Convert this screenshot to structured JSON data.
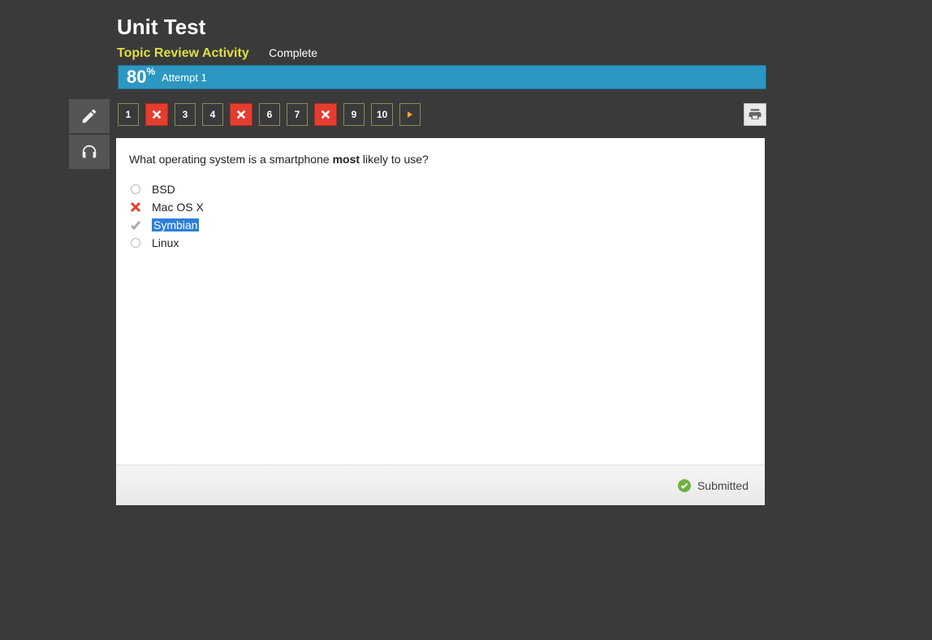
{
  "header": {
    "title": "Unit Test",
    "activity": "Topic Review Activity",
    "status": "Complete"
  },
  "scorebar": {
    "score": "80",
    "percent": "%",
    "attempt": "Attempt 1"
  },
  "nav": {
    "items": [
      {
        "label": "1",
        "wrong": false
      },
      {
        "label": "",
        "wrong": true
      },
      {
        "label": "3",
        "wrong": false
      },
      {
        "label": "4",
        "wrong": false
      },
      {
        "label": "",
        "wrong": true
      },
      {
        "label": "6",
        "wrong": false
      },
      {
        "label": "7",
        "wrong": false
      },
      {
        "label": "",
        "wrong": true
      },
      {
        "label": "9",
        "wrong": false
      },
      {
        "label": "10",
        "wrong": false
      }
    ]
  },
  "question": {
    "pre": "What operating system is a smartphone ",
    "bold": "most",
    "post": " likely to use?",
    "options": [
      {
        "label": "BSD",
        "icon": "empty",
        "highlight": false
      },
      {
        "label": "Mac OS X",
        "icon": "wrong",
        "highlight": false
      },
      {
        "label": "Symbian",
        "icon": "correct",
        "highlight": true
      },
      {
        "label": "Linux",
        "icon": "empty",
        "highlight": false
      }
    ]
  },
  "footer": {
    "status": "Submitted"
  }
}
